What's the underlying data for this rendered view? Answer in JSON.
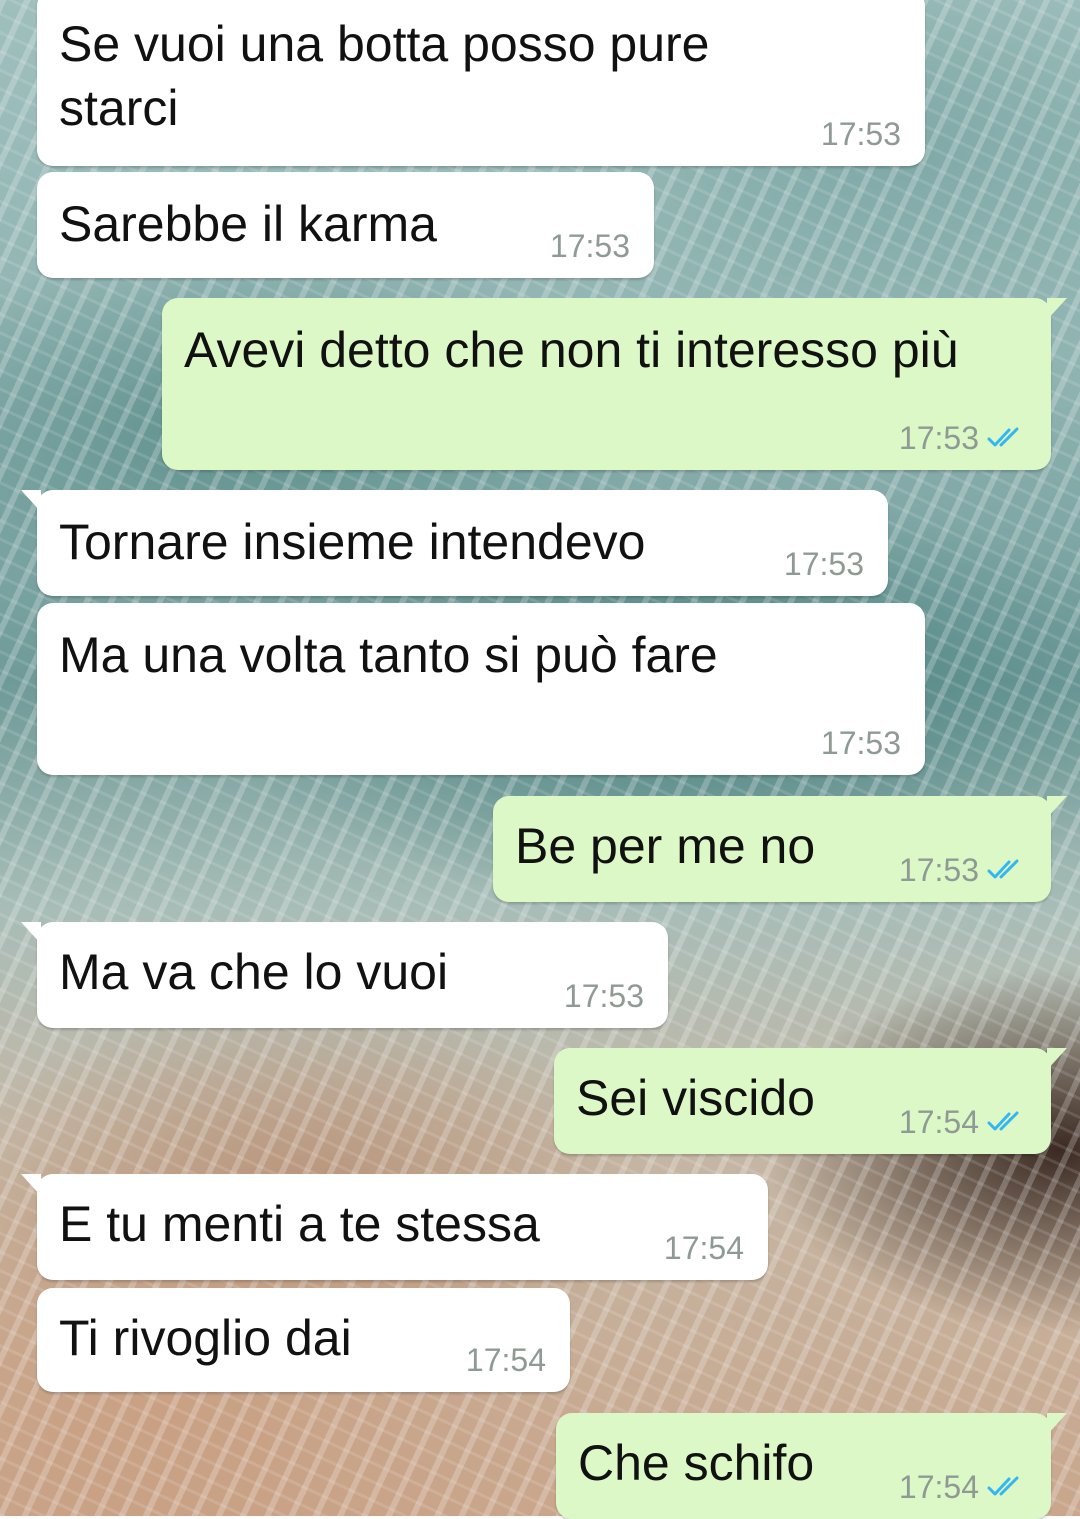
{
  "theme": {
    "incoming_bubble": "#ffffff",
    "outgoing_bubble": "#dcf8c6",
    "timestamp_color": "#8f9a94",
    "read_tick_color": "#34b7f1"
  },
  "messages": [
    {
      "direction": "incoming",
      "text": "Se vuoi una botta posso pure starci",
      "time": "17:53"
    },
    {
      "direction": "incoming",
      "text": "Sarebbe il karma",
      "time": "17:53"
    },
    {
      "direction": "outgoing",
      "text": "Avevi detto che non ti interesso più",
      "time": "17:53",
      "status": "read-double-tick-icon"
    },
    {
      "direction": "incoming",
      "text": "Tornare insieme intendevo",
      "time": "17:53"
    },
    {
      "direction": "incoming",
      "text": "Ma una volta tanto si può fare",
      "time": "17:53"
    },
    {
      "direction": "outgoing",
      "text": "Be per me no",
      "time": "17:53",
      "status": "read-double-tick-icon"
    },
    {
      "direction": "incoming",
      "text": "Ma va che lo vuoi",
      "time": "17:53"
    },
    {
      "direction": "outgoing",
      "text": "Sei viscido",
      "time": "17:54",
      "status": "read-double-tick-icon"
    },
    {
      "direction": "incoming",
      "text": "E tu menti a te stessa",
      "time": "17:54"
    },
    {
      "direction": "incoming",
      "text": "Ti rivoglio dai",
      "time": "17:54"
    },
    {
      "direction": "outgoing",
      "text": "Che schifo",
      "time": "17:54",
      "status": "read-double-tick-icon"
    }
  ]
}
